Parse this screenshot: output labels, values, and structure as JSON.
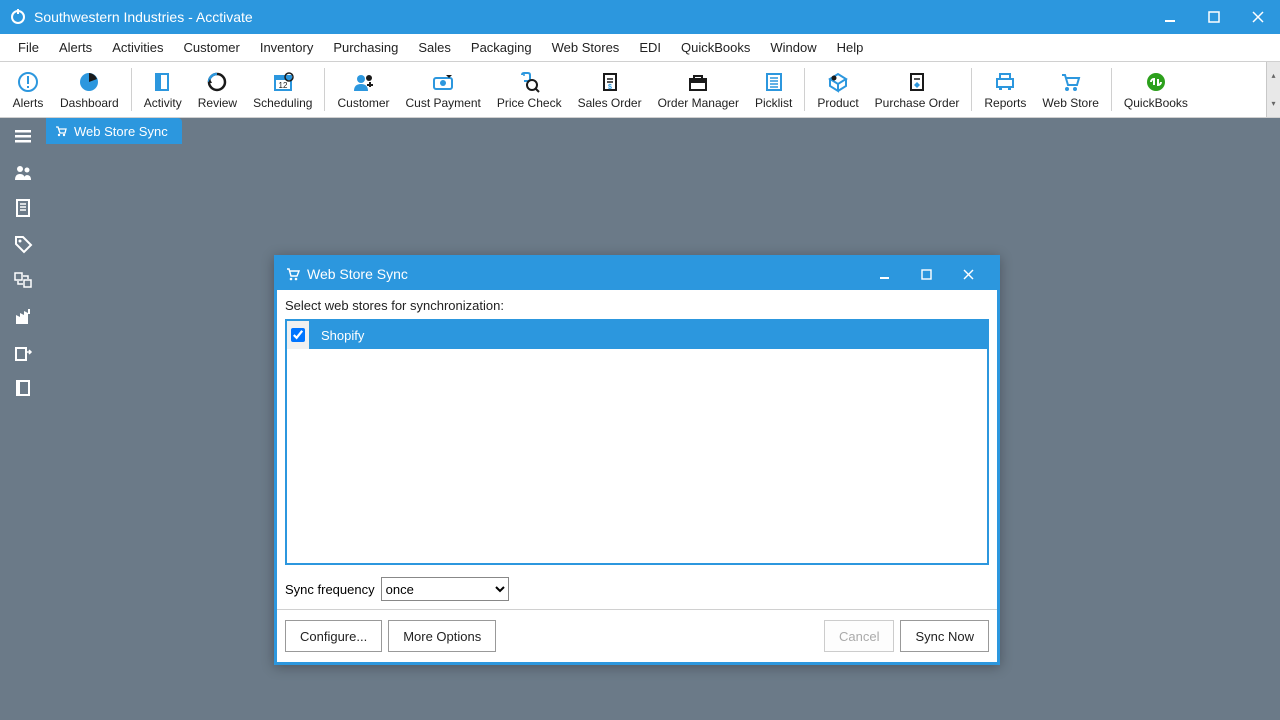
{
  "window": {
    "title": "Southwestern Industries - Acctivate"
  },
  "menu": {
    "items": [
      "File",
      "Alerts",
      "Activities",
      "Customer",
      "Inventory",
      "Purchasing",
      "Sales",
      "Packaging",
      "Web Stores",
      "EDI",
      "QuickBooks",
      "Window",
      "Help"
    ]
  },
  "toolbar": {
    "buttons": [
      {
        "label": "Alerts",
        "icon": "alert"
      },
      {
        "label": "Dashboard",
        "icon": "dashboard"
      },
      {
        "sep": true
      },
      {
        "label": "Activity",
        "icon": "activity"
      },
      {
        "label": "Review",
        "icon": "review"
      },
      {
        "label": "Scheduling",
        "icon": "scheduling"
      },
      {
        "sep": true
      },
      {
        "label": "Customer",
        "icon": "customer"
      },
      {
        "label": "Cust Payment",
        "icon": "payment"
      },
      {
        "label": "Price Check",
        "icon": "pricecheck"
      },
      {
        "label": "Sales Order",
        "icon": "salesorder"
      },
      {
        "label": "Order Manager",
        "icon": "ordermanager"
      },
      {
        "label": "Picklist",
        "icon": "picklist"
      },
      {
        "sep": true
      },
      {
        "label": "Product",
        "icon": "product"
      },
      {
        "label": "Purchase Order",
        "icon": "po"
      },
      {
        "sep": true
      },
      {
        "label": "Reports",
        "icon": "reports"
      },
      {
        "label": "Web Store",
        "icon": "webstore"
      },
      {
        "sep": true
      },
      {
        "label": "QuickBooks",
        "icon": "qb"
      }
    ]
  },
  "tabs": {
    "active": {
      "label": "Web Store Sync"
    }
  },
  "sidebar": {
    "items": [
      "menu",
      "users",
      "document",
      "tag",
      "transfer",
      "factory",
      "export",
      "book"
    ]
  },
  "dialog": {
    "title": "Web Store Sync",
    "prompt": "Select web stores for synchronization:",
    "stores": [
      {
        "name": "Shopify",
        "checked": true,
        "selected": true
      }
    ],
    "freq_label": "Sync frequency",
    "freq_value": "once",
    "buttons": {
      "configure": "Configure...",
      "more": "More Options",
      "cancel": "Cancel",
      "sync": "Sync Now"
    }
  }
}
